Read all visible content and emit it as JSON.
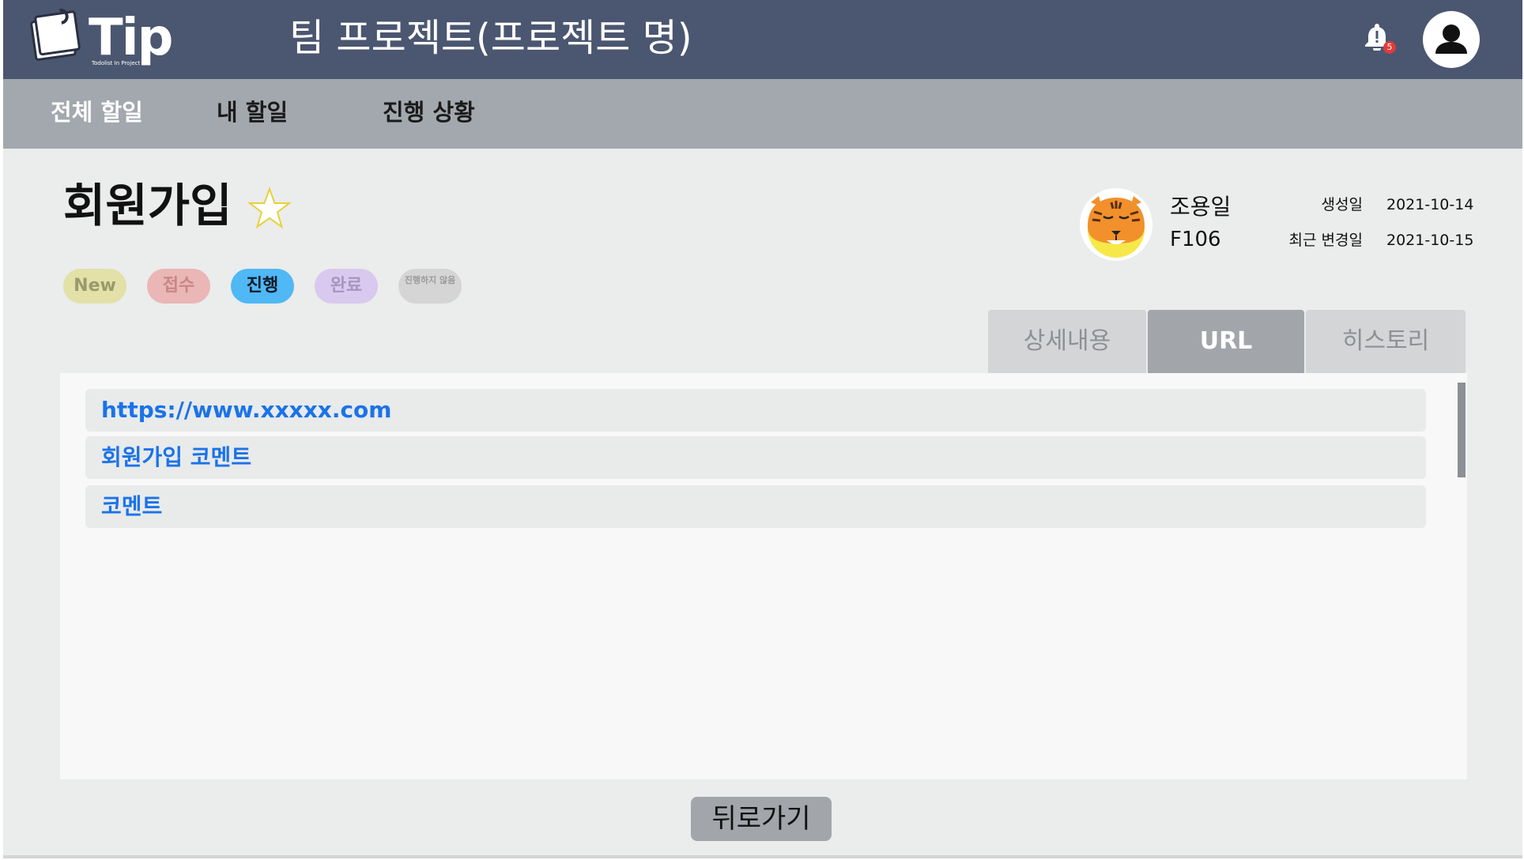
{
  "header": {
    "logo_text": "Tip",
    "logo_subtitle": "Todolist In Project",
    "project_title": "팀 프로젝트(프로젝트 명)",
    "notification_count": "5",
    "colors": {
      "header_bg": "#4b5670",
      "badge": "#e03b3b"
    }
  },
  "nav": {
    "items": [
      {
        "label": "전체 할일",
        "active": true
      },
      {
        "label": "내 할일",
        "active": false
      },
      {
        "label": "진행 상황",
        "active": false
      }
    ]
  },
  "task": {
    "title": "회원가입",
    "favorite": false,
    "statuses": [
      {
        "label": "New",
        "bg": "#e3e0a8",
        "color": "#9a9a6c"
      },
      {
        "label": "접수",
        "bg": "#eab6b6",
        "color": "#c98686"
      },
      {
        "label": "진행",
        "bg": "#4fb8f5",
        "color": "#0d1a26"
      },
      {
        "label": "완료",
        "bg": "#d9c9ee",
        "color": "#a795bf"
      },
      {
        "label": "진행하지 않음",
        "bg": "#d5d5d5",
        "color": "#9b9b9b"
      }
    ],
    "selected_status": "진행"
  },
  "assignee": {
    "name": "조용일",
    "room": "F106",
    "avatar_icon": "tiger-face-icon"
  },
  "meta": {
    "created_label": "생성일",
    "created_value": "2021-10-14",
    "modified_label": "최근 변경일",
    "modified_value": "2021-10-15"
  },
  "tabs": [
    {
      "label": "상세내용",
      "active": false
    },
    {
      "label": "URL",
      "active": true
    },
    {
      "label": "히스토리",
      "active": false
    }
  ],
  "urls": [
    "https://www.xxxxx.com",
    "회원가입 코멘트",
    "코멘트"
  ],
  "footer": {
    "back_label": "뒤로가기"
  }
}
